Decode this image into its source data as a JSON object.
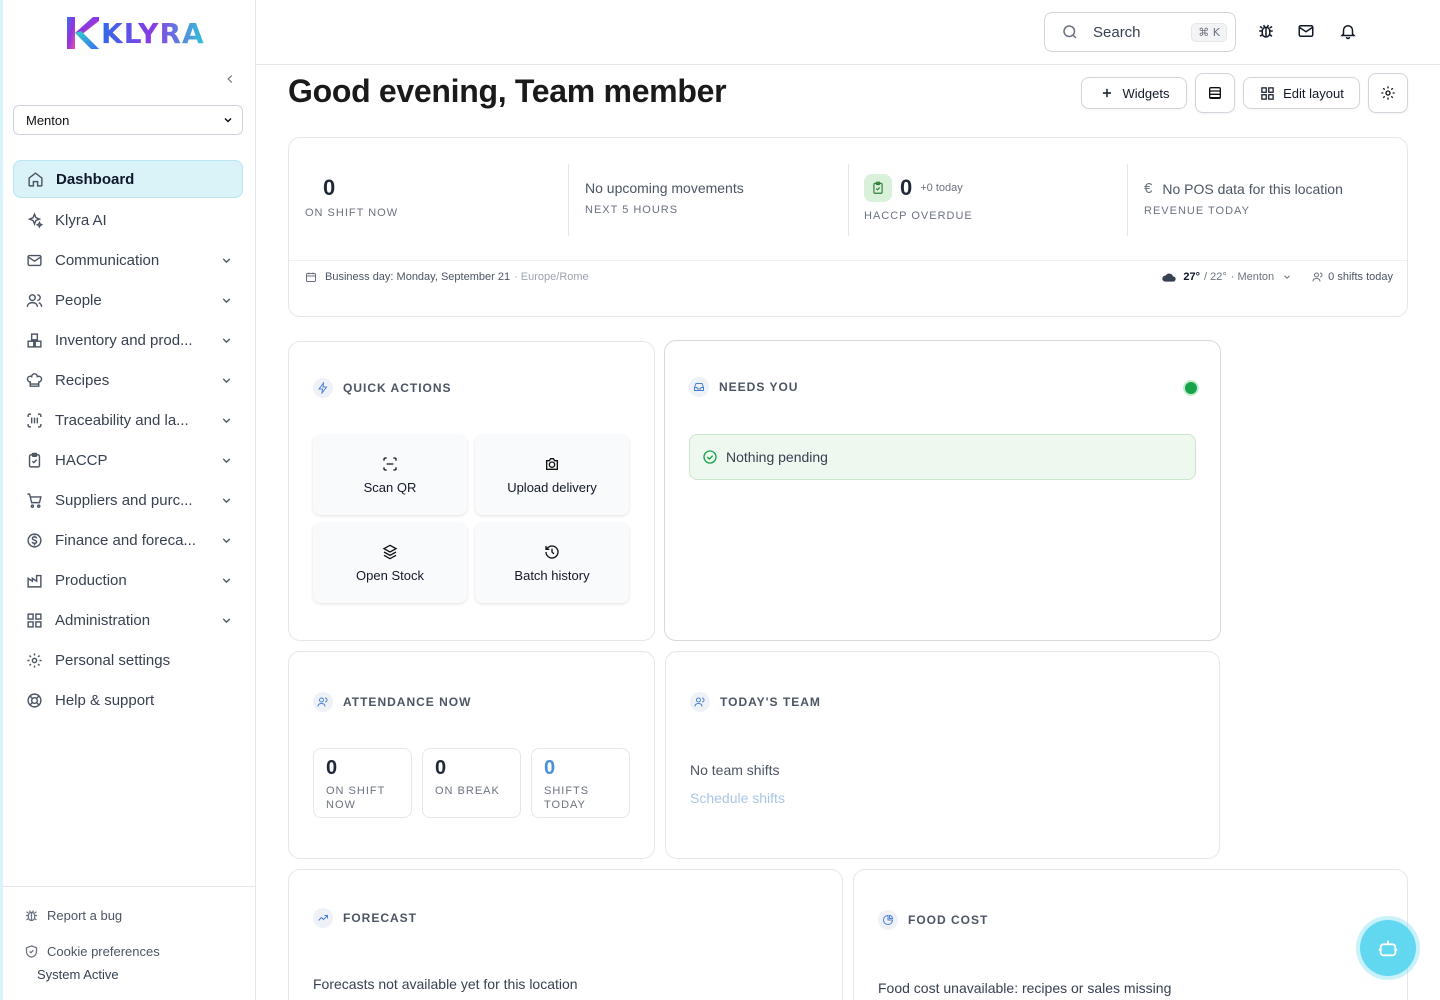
{
  "brand": {
    "name": "KLYRA"
  },
  "sidebar": {
    "location": "Menton",
    "items": [
      {
        "label": "Dashboard",
        "icon": "home-icon",
        "active": true,
        "expandable": false
      },
      {
        "label": "Klyra AI",
        "icon": "sparkles-icon",
        "expandable": false
      },
      {
        "label": "Communication",
        "icon": "mail-icon",
        "expandable": true
      },
      {
        "label": "People",
        "icon": "users-icon",
        "expandable": true
      },
      {
        "label": "Inventory and prod...",
        "icon": "boxes-icon",
        "expandable": true
      },
      {
        "label": "Recipes",
        "icon": "chef-hat-icon",
        "expandable": true
      },
      {
        "label": "Traceability and la...",
        "icon": "scan-barcode-icon",
        "expandable": true
      },
      {
        "label": "HACCP",
        "icon": "clipboard-icon",
        "expandable": true
      },
      {
        "label": "Suppliers and purc...",
        "icon": "cart-icon",
        "expandable": true
      },
      {
        "label": "Finance and foreca...",
        "icon": "dollar-icon",
        "expandable": true
      },
      {
        "label": "Production",
        "icon": "factory-icon",
        "expandable": true
      },
      {
        "label": "Administration",
        "icon": "grid-icon",
        "expandable": true
      },
      {
        "label": "Personal settings",
        "icon": "gear-icon",
        "expandable": false
      },
      {
        "label": "Help & support",
        "icon": "lifebuoy-icon",
        "expandable": false
      }
    ],
    "footer": {
      "report_bug": "Report a bug",
      "cookie": "Cookie preferences",
      "status": "System Active"
    }
  },
  "topbar": {
    "search_label": "Search",
    "search_kbd": "⌘ K"
  },
  "main": {
    "greeting": "Good evening, Team member",
    "toolbar": {
      "widgets": "Widgets",
      "edit_layout": "Edit layout"
    },
    "summary": {
      "on_shift_value": "0",
      "on_shift_caption": "ON SHIFT NOW",
      "movements_title": "No upcoming movements",
      "movements_caption": "NEXT 5 HOURS",
      "haccp_value": "0",
      "haccp_delta": "+0 today",
      "haccp_caption": "HACCP OVERDUE",
      "pos_title": "No POS data for this location",
      "pos_caption": "REVENUE TODAY",
      "business_day": "Business day: Monday, September 21",
      "timezone": "· Europe/Rome",
      "temp_high": "27°",
      "temp_low": "/ 22°",
      "weather_location": "· Menton",
      "shifts_today": "0 shifts today"
    },
    "quick_actions": {
      "title": "QUICK ACTIONS",
      "actions": [
        {
          "label": "Scan QR",
          "icon": "scan-icon"
        },
        {
          "label": "Upload delivery",
          "icon": "camera-icon"
        },
        {
          "label": "Open Stock",
          "icon": "package-icon"
        },
        {
          "label": "Batch history",
          "icon": "history-icon"
        }
      ]
    },
    "needs_you": {
      "title": "NEEDS YOU",
      "pending": "Nothing pending",
      "status_color": "#16a34a"
    },
    "attendance": {
      "title": "ATTENDANCE NOW",
      "boxes": [
        {
          "value": "0",
          "caption": "ON SHIFT NOW"
        },
        {
          "value": "0",
          "caption": "ON BREAK"
        },
        {
          "value": "0",
          "caption": "SHIFTS TODAY"
        }
      ]
    },
    "team": {
      "title": "TODAY'S TEAM",
      "empty": "No team shifts",
      "link": "Schedule shifts"
    },
    "forecast": {
      "title": "FORECAST",
      "empty": "Forecasts not available yet for this location"
    },
    "food_cost": {
      "title": "FOOD COST",
      "empty": "Food cost unavailable: recipes or sales missing"
    }
  },
  "colors": {
    "accent": "#62d8f0",
    "active_bg": "#d9f3f8",
    "link_muted": "#a9c5e6",
    "blue_value": "#4a90d9"
  }
}
